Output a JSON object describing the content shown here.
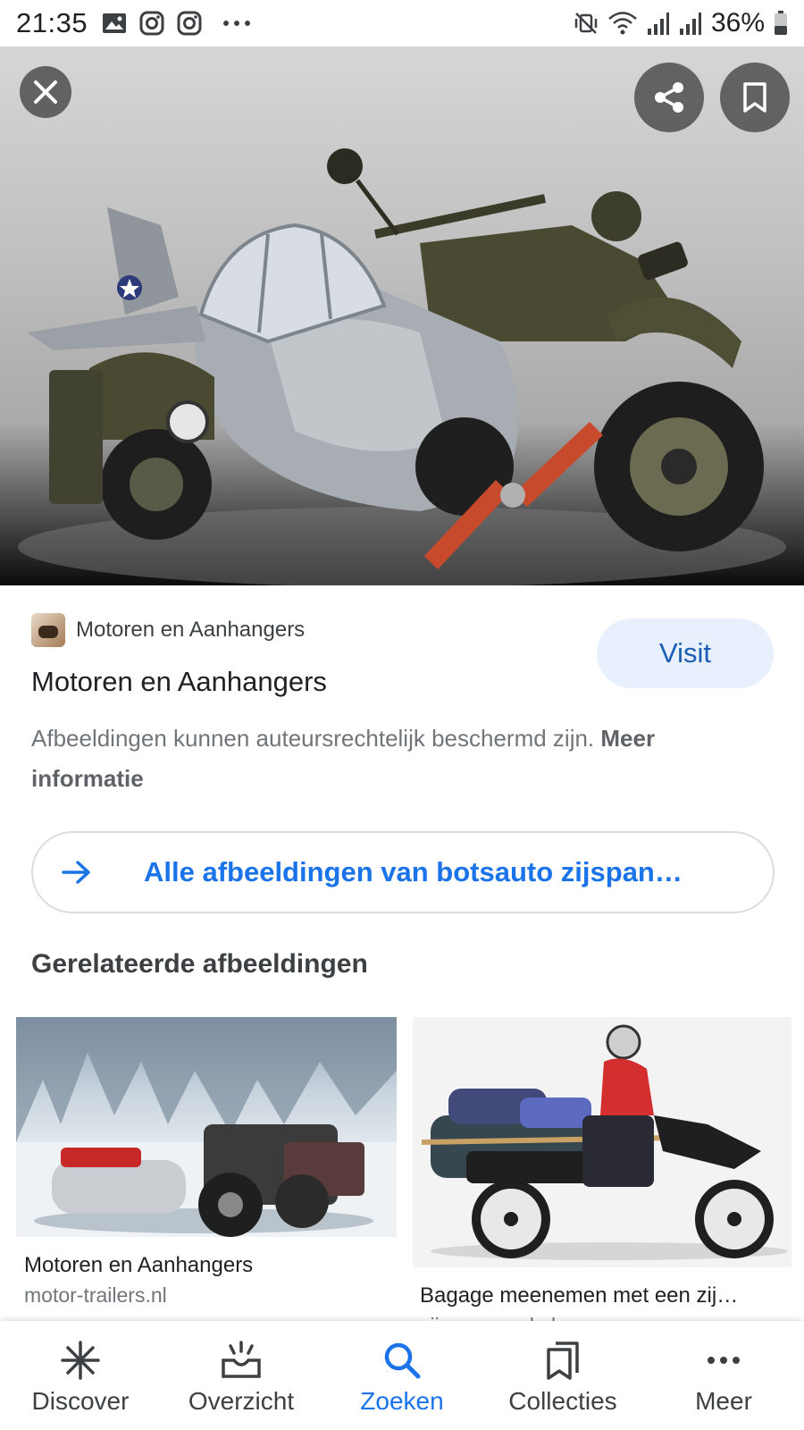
{
  "status_bar": {
    "time": "21:35",
    "battery": "36%",
    "left_icons": [
      "gallery-icon",
      "instagram-icon",
      "instagram-icon",
      "more-dots-icon"
    ],
    "right_icons": [
      "mute-vibrate-icon",
      "wifi-icon",
      "signal-icon",
      "signal-icon",
      "battery-icon"
    ]
  },
  "viewer": {
    "close_icon": "close-icon",
    "share_icon": "share-icon",
    "save_icon": "bookmark-icon"
  },
  "source": {
    "site_name": "Motoren en Aanhangers",
    "visit_label": "Visit",
    "page_title": "Motoren en Aanhangers",
    "copyright_text": "Afbeeldingen kunnen auteursrechtelijk beschermd zijn. ",
    "more_info_label": "Meer informatie"
  },
  "all_images": {
    "label": "Alle afbeeldingen van botsauto zijspan…",
    "icon": "arrow-right-icon"
  },
  "related": {
    "section_title": "Gerelateerde afbeeldingen",
    "items": [
      {
        "title": "Motoren en Aanhangers",
        "domain": "motor-trailers.nl"
      },
      {
        "title": "Bagage meenemen met een zij…",
        "domain": "zijspanpanel.nl"
      }
    ]
  },
  "bottom_nav": {
    "items": [
      {
        "label": "Discover",
        "icon": "asterisk-icon"
      },
      {
        "label": "Overzicht",
        "icon": "inbox-tray-icon"
      },
      {
        "label": "Zoeken",
        "icon": "search-icon"
      },
      {
        "label": "Collecties",
        "icon": "collections-icon"
      },
      {
        "label": "Meer",
        "icon": "more-dots-icon"
      }
    ],
    "active_index": 2
  },
  "colors": {
    "accent": "#1a73e8",
    "visit_bg": "#e8f0fe",
    "text_primary": "#202124",
    "text_secondary": "#70757a"
  }
}
